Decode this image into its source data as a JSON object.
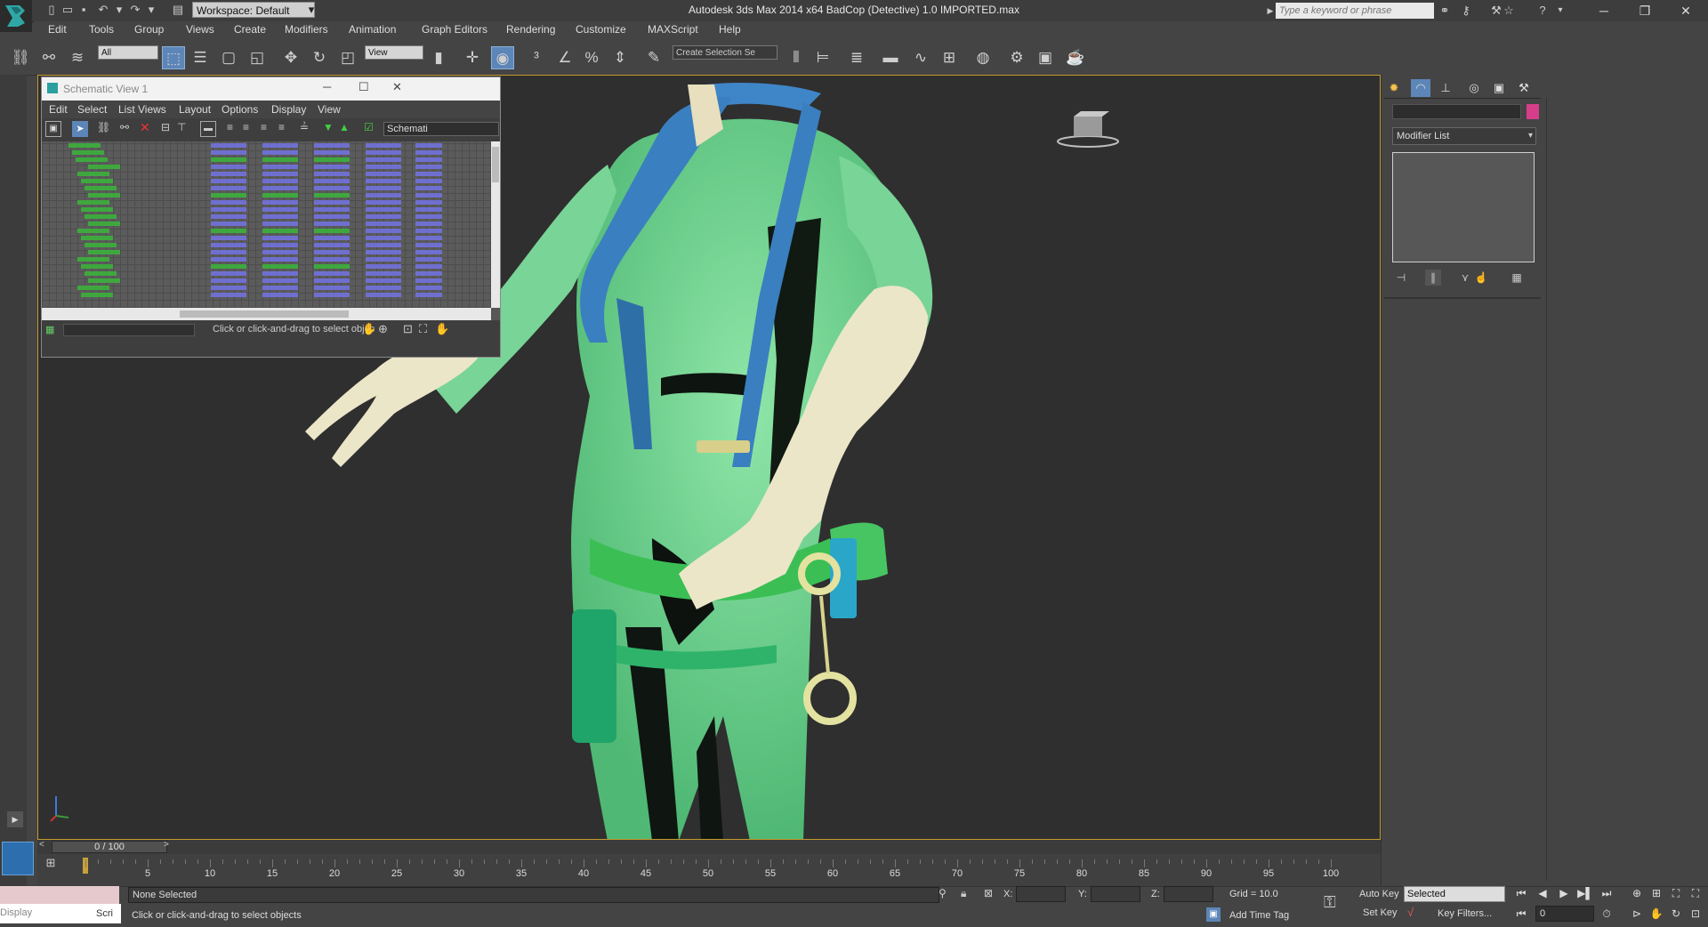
{
  "title_bar": {
    "workspace": "Workspace: Default",
    "window_title": "Autodesk 3ds Max  2014 x64      BadCop (Detective) 1.0 IMPORTED.max",
    "search_placeholder": "Type a keyword or phrase"
  },
  "menu": [
    "Edit",
    "Tools",
    "Group",
    "Views",
    "Create",
    "Modifiers",
    "Animation",
    "Graph Editors",
    "Rendering",
    "Customize",
    "MAXScript",
    "Help"
  ],
  "toolbar": {
    "selection_filter": "All",
    "ref_coord": "View",
    "named_selection": "Create Selection Se"
  },
  "schematic": {
    "title": "Schematic View 1",
    "menu": [
      "Edit",
      "Select",
      "List Views",
      "Layout",
      "Options",
      "Display",
      "View"
    ],
    "view_field": "Schemati",
    "status_hint": "Click or click-and-drag to select objec"
  },
  "command_panel": {
    "modifier_list": "Modifier List",
    "object_color": "#d63e8a"
  },
  "timeline": {
    "slider": "0 / 100",
    "ticks": [
      "5",
      "10",
      "15",
      "20",
      "25",
      "30",
      "35",
      "40",
      "45",
      "50",
      "55",
      "60",
      "65",
      "70",
      "75",
      "80",
      "85",
      "90",
      "95",
      "100"
    ]
  },
  "status": {
    "selection": "None Selected",
    "prompt": "Click or click-and-drag to select objects",
    "x_label": "X:",
    "y_label": "Y:",
    "z_label": "Z:",
    "grid": "Grid = 10.0",
    "add_time_tag": "Add Time Tag",
    "auto_key": "Auto Key",
    "set_key": "Set Key",
    "key_mode": "Selected",
    "key_filters": "Key Filters...",
    "frame": "0",
    "listener_label": "Display",
    "script_label": "Scri"
  }
}
